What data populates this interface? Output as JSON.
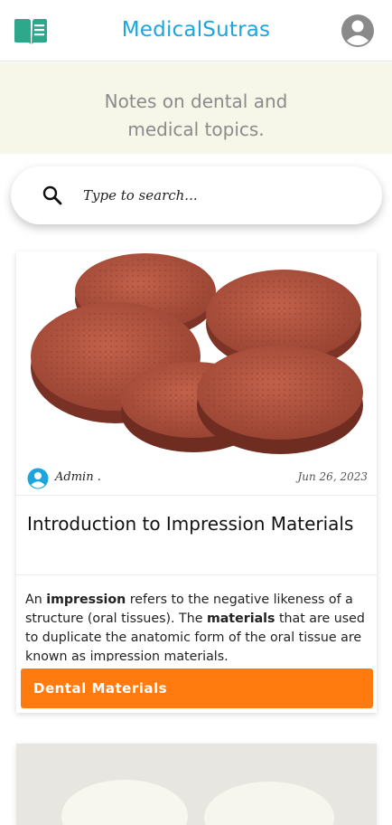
{
  "header": {
    "site_title": "MedicalSutras",
    "menu_icon": "book-icon",
    "account_icon": "account-circle-icon",
    "accent_color": "#1ea5dc",
    "icon_color": "#2ea88c"
  },
  "tagline": {
    "line1": "Notes on dental and",
    "line2": "medical topics."
  },
  "search": {
    "placeholder": "Type to search..."
  },
  "posts": [
    {
      "author": "Admin .",
      "date": "Jun 26, 2023",
      "title": "Introduction to Impression Materials",
      "excerpt": {
        "p1": "An ",
        "b1": "impression",
        "p2": " refers to the negative likeness of a structure (oral tissues). The ",
        "b2": "materials",
        "p3": " that are used to duplicate the anatomic form of the oral tissue are known as impression materials."
      },
      "category": "Dental Materials",
      "category_color": "#ff7a0f"
    }
  ]
}
